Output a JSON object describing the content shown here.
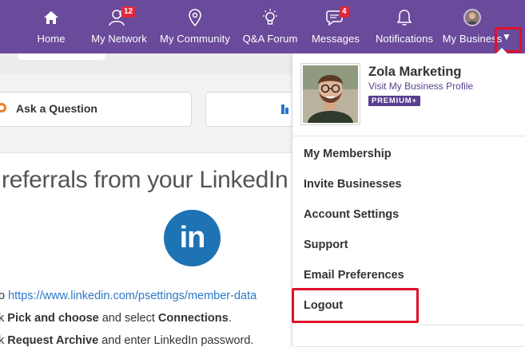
{
  "nav": {
    "items": [
      {
        "label": "Home",
        "icon": "home-icon"
      },
      {
        "label": "My Network",
        "icon": "network-icon",
        "badge": "12"
      },
      {
        "label": "My Community",
        "icon": "map-pin-icon"
      },
      {
        "label": "Q&A Forum",
        "icon": "lightbulb-icon"
      },
      {
        "label": "Messages",
        "icon": "chat-icon",
        "badge": "4"
      },
      {
        "label": "Notifications",
        "icon": "bell-icon"
      },
      {
        "label": "My Business",
        "icon": "avatar"
      }
    ],
    "caret": "▼",
    "accent_color": "#6a4a9a"
  },
  "background": {
    "ask_label": "Ask a Question",
    "heading": "referrals from your LinkedIn",
    "logo_text": "in",
    "line1_prefix": "o ",
    "line1_link": "https://www.linkedin.com/psettings/member-data",
    "line2_prefix": "k ",
    "line2_bold1": "Pick and choose",
    "line2_mid": " and select ",
    "line2_bold2": "Connections",
    "line2_end": ".",
    "line3_prefix": "k ",
    "line3_bold": "Request Archive",
    "line3_end": " and enter LinkedIn password."
  },
  "dropdown": {
    "profile_name": "Zola Marketing",
    "profile_link": "Visit My Business Profile",
    "premium_label": "PREMIUM+",
    "items": [
      "My Membership",
      "Invite Businesses",
      "Account Settings",
      "Support",
      "Email Preferences",
      "Logout"
    ]
  },
  "highlight_color": "#e0102a"
}
